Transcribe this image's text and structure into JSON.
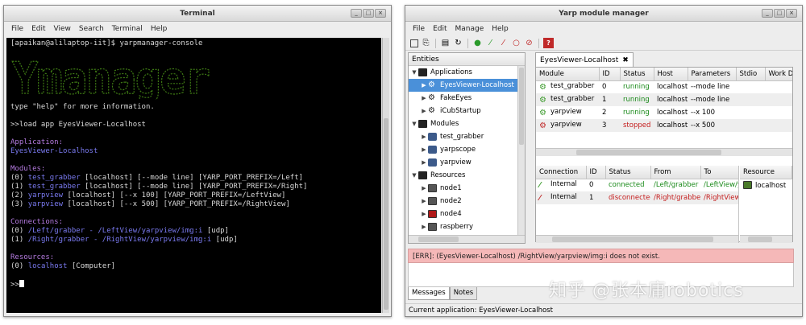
{
  "terminal": {
    "title": "Terminal",
    "menu": [
      "File",
      "Edit",
      "View",
      "Search",
      "Terminal",
      "Help"
    ],
    "banner": "Ymanager",
    "prompt_line": "[apaikan@alilaptop-iit]$ yarpmanager-console",
    "help_line": "type \"help\" for more information.",
    "load_cmd": ">>load app EyesViewer-Localhost",
    "application_header": "Application:",
    "application_name": "EyesViewer-Localhost",
    "modules_header": "Modules:",
    "modules": [
      {
        "idx": "(0)",
        "name": "test_grabber",
        "rest": " [localhost] [--mode line] [YARP_PORT_PREFIX=/Left]"
      },
      {
        "idx": "(1)",
        "name": "test_grabber",
        "rest": " [localhost] [--mode line] [YARP_PORT_PREFIX=/Right]"
      },
      {
        "idx": "(2)",
        "name": "yarpview",
        "rest": " [localhost] [--x 100] [YARP_PORT_PREFIX=/LeftView]"
      },
      {
        "idx": "(3)",
        "name": "yarpview",
        "rest": " [localhost] [--x 500] [YARP_PORT_PREFIX=/RightView]"
      }
    ],
    "connections_header": "Connections:",
    "connections": [
      {
        "idx": "(0)",
        "path": "/Left/grabber - /LeftView/yarpview/img:i",
        "rest": " [udp]"
      },
      {
        "idx": "(1)",
        "path": "/Right/grabber - /RightView/yarpview/img:i",
        "rest": " [udp]"
      }
    ],
    "resources_header": "Resources:",
    "resources": [
      {
        "idx": "(0)",
        "name": "localhost",
        "rest": " [Computer]"
      }
    ],
    "final_prompt": ">>"
  },
  "yarp": {
    "title": "Yarp module manager",
    "menu": [
      "File",
      "Edit",
      "Manage",
      "Help"
    ],
    "entities_header": "Entities",
    "tree": [
      {
        "arrow": "▼",
        "indent": 0,
        "icon": "folder",
        "label": "Applications"
      },
      {
        "arrow": "▶",
        "indent": 1,
        "icon": "gears",
        "label": "EyesViewer-Localhost",
        "selected": true
      },
      {
        "arrow": "▶",
        "indent": 1,
        "icon": "gears",
        "label": "FakeEyes"
      },
      {
        "arrow": "▶",
        "indent": 1,
        "icon": "gears",
        "label": "iCubStartup"
      },
      {
        "arrow": "▼",
        "indent": 0,
        "icon": "folder",
        "label": "Modules"
      },
      {
        "arrow": "▶",
        "indent": 1,
        "icon": "mod",
        "label": "test_grabber"
      },
      {
        "arrow": "▶",
        "indent": 1,
        "icon": "mod",
        "label": "yarpscope"
      },
      {
        "arrow": "▶",
        "indent": 1,
        "icon": "mod",
        "label": "yarpview"
      },
      {
        "arrow": "▼",
        "indent": 0,
        "icon": "folder",
        "label": "Resources"
      },
      {
        "arrow": "▶",
        "indent": 1,
        "icon": "pc",
        "label": "node1"
      },
      {
        "arrow": "▶",
        "indent": 1,
        "icon": "pc",
        "label": "node2"
      },
      {
        "arrow": "▶",
        "indent": 1,
        "icon": "pc-red",
        "label": "node4"
      },
      {
        "arrow": "▶",
        "indent": 1,
        "icon": "pc",
        "label": "raspberry"
      }
    ],
    "tab_label": "EyesViewer-Localhost",
    "module_columns": [
      "Module",
      "ID",
      "Status",
      "Host",
      "Parameters",
      "Stdio",
      "Work D"
    ],
    "modules": [
      {
        "module": "test_grabber",
        "id": "0",
        "status": "running",
        "host": "localhost",
        "params": "--mode line",
        "stdio": "",
        "workdir": ""
      },
      {
        "module": "test_grabber",
        "id": "1",
        "status": "running",
        "host": "localhost",
        "params": "--mode line",
        "stdio": "",
        "workdir": ""
      },
      {
        "module": "yarpview",
        "id": "2",
        "status": "running",
        "host": "localhost",
        "params": "--x 100",
        "stdio": "",
        "workdir": ""
      },
      {
        "module": "yarpview",
        "id": "3",
        "status": "stopped",
        "host": "localhost",
        "params": "--x 500",
        "stdio": "",
        "workdir": ""
      }
    ],
    "connection_columns": [
      "Connection",
      "ID",
      "Status",
      "From",
      "To"
    ],
    "connections": [
      {
        "conn": "Internal",
        "id": "0",
        "status": "connected",
        "from": "/Left/grabber",
        "to": "/LeftView/y"
      },
      {
        "conn": "Internal",
        "id": "1",
        "status": "disconnected",
        "from": "/Right/grabber",
        "to": "/RightView/"
      }
    ],
    "resource_columns": [
      "Resource"
    ],
    "resources": [
      {
        "name": "localhost"
      }
    ],
    "error_message": "[ERR]:   (EyesViewer-Localhost) /RightView/yarpview/img:i does not exist.",
    "bottom_tabs": [
      "Messages",
      "Notes"
    ],
    "status_bar": "Current application: EyesViewer-Localhost",
    "watermark": "知乎 @张本庸robotics",
    "colors": {
      "running": "#1a8a1a",
      "stopped": "#c41b1b",
      "error_bg": "#f5b8b8",
      "selection": "#4a90d9"
    }
  }
}
